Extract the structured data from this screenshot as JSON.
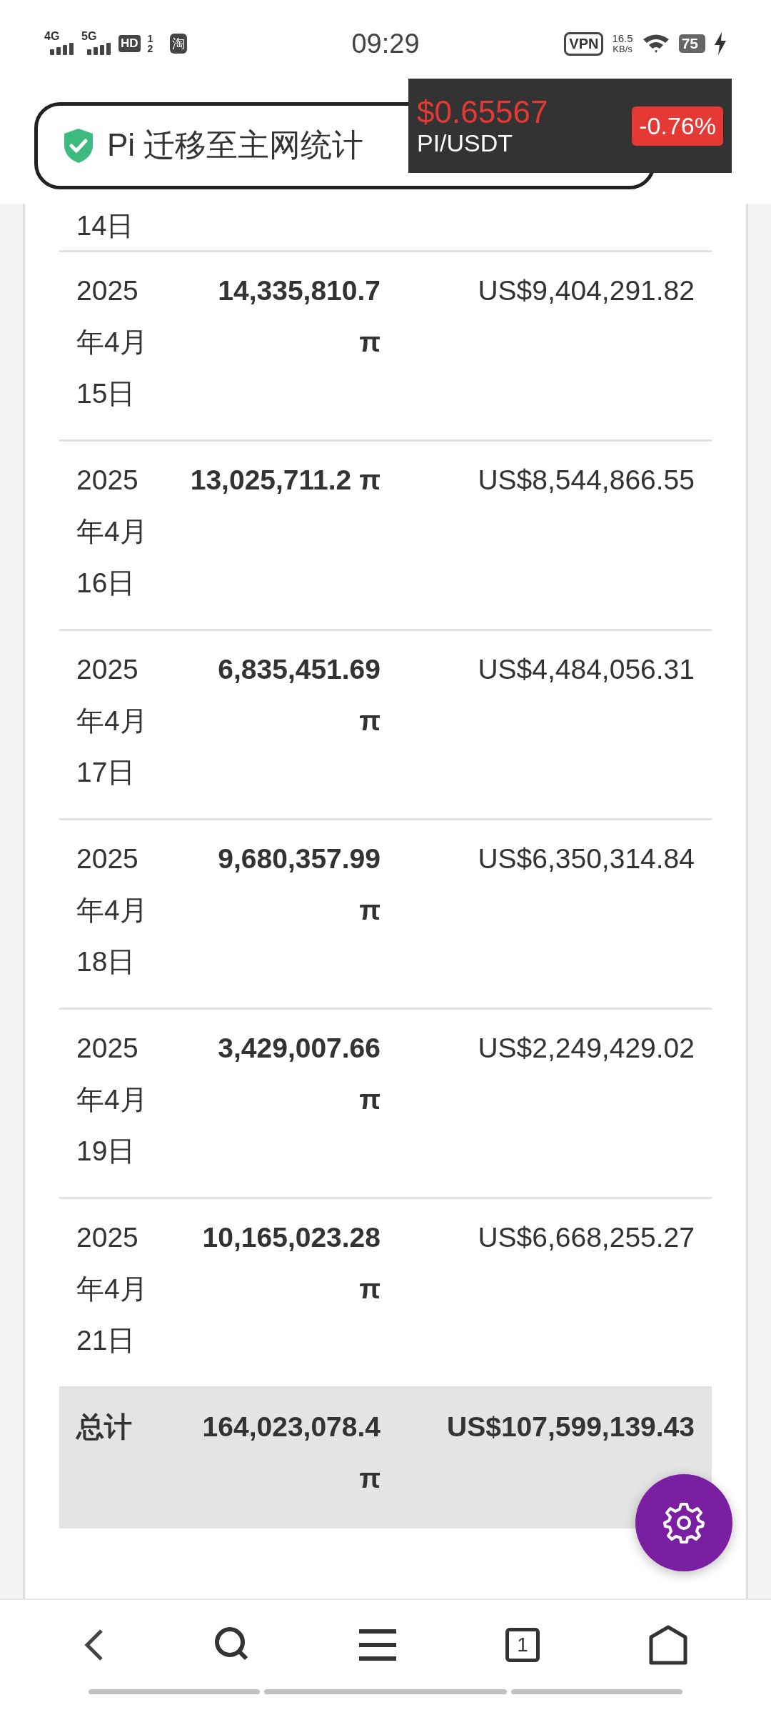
{
  "status_bar": {
    "network_1": "4G",
    "network_2": "5G",
    "hd": "HD",
    "hd_sub_1": "1",
    "hd_sub_2": "2",
    "app_badge": "淘",
    "time": "09:29",
    "vpn": "VPN",
    "speed_value": "16.5",
    "speed_unit": "KB/s",
    "battery": "75"
  },
  "address_bar": {
    "title": "Pi 迁移至主网统计"
  },
  "price_popup": {
    "price": "$0.65567",
    "pair": "PI/USDT",
    "change": "-0.76%"
  },
  "table": {
    "cut_row_date": "14日",
    "rows": [
      {
        "date": "2025年4月15日",
        "amount": "14,335,810.7 π",
        "usd": "US$9,404,291.82"
      },
      {
        "date": "2025年4月16日",
        "amount": "13,025,711.2 π",
        "usd": "US$8,544,866.55"
      },
      {
        "date": "2025年4月17日",
        "amount": "6,835,451.69 π",
        "usd": "US$4,484,056.31"
      },
      {
        "date": "2025年4月18日",
        "amount": "9,680,357.99 π",
        "usd": "US$6,350,314.84"
      },
      {
        "date": "2025年4月19日",
        "amount": "3,429,007.66 π",
        "usd": "US$2,249,429.02"
      },
      {
        "date": "2025年4月21日",
        "amount": "10,165,023.28 π",
        "usd": "US$6,668,255.27"
      }
    ],
    "total": {
      "label": "总计",
      "amount": "164,023,078.4 π",
      "usd": "US$107,599,139.43"
    }
  },
  "bottom_nav": {
    "tab_count": "1"
  }
}
